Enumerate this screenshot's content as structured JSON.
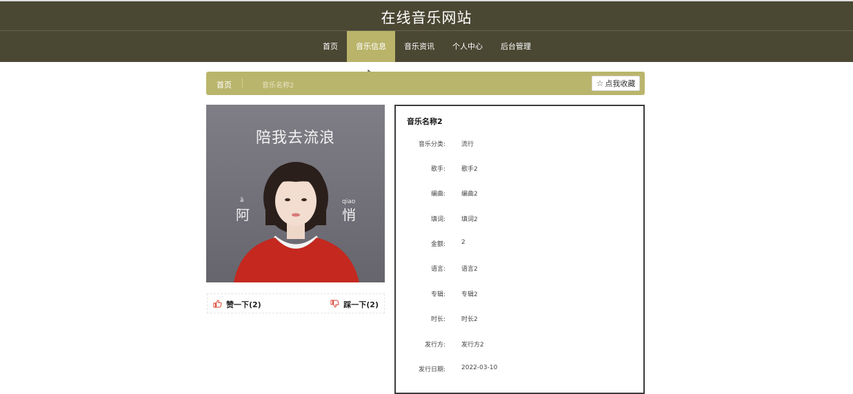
{
  "site": {
    "title": "在线音乐网站"
  },
  "nav": {
    "items": [
      "首页",
      "音乐信息",
      "音乐资讯",
      "个人中心",
      "后台管理"
    ],
    "active_index": 1
  },
  "breadcrumb": {
    "home": "首页",
    "current": "音乐名称2"
  },
  "favorite": {
    "label": "点我收藏",
    "icon": "star-icon"
  },
  "cover": {
    "title_text": "陪我去流浪",
    "artist_text_left": "阿",
    "artist_text_right": "悄",
    "pinyin_left": "ā",
    "pinyin_right": "qiao"
  },
  "votes": {
    "like_label": "赞一下(2)",
    "dislike_label": "踩一下(2)",
    "like_icon": "thumbs-up-icon",
    "dislike_icon": "thumbs-down-icon"
  },
  "detail": {
    "title": "音乐名称2",
    "fields": [
      {
        "label": "音乐分类:",
        "value": "流行"
      },
      {
        "label": "歌手:",
        "value": "歌手2"
      },
      {
        "label": "编曲:",
        "value": "编曲2"
      },
      {
        "label": "填词:",
        "value": "填词2"
      },
      {
        "label": "金额:",
        "value": "2"
      },
      {
        "label": "语言:",
        "value": "语言2"
      },
      {
        "label": "专辑:",
        "value": "专辑2"
      },
      {
        "label": "时长:",
        "value": "时长2"
      },
      {
        "label": "发行方:",
        "value": "发行方2"
      },
      {
        "label": "发行日期:",
        "value": "2022-03-10"
      }
    ]
  },
  "colors": {
    "header_bg": "#4a4733",
    "accent": "#bab56c",
    "vote_icon": "#d9412e"
  }
}
